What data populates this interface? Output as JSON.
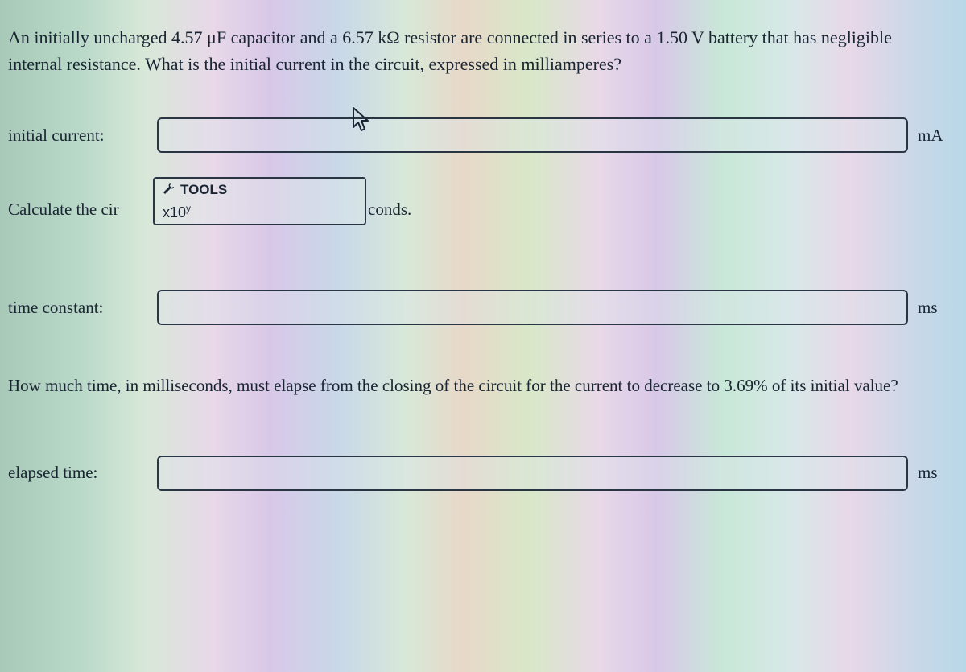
{
  "question": {
    "part1": "An initially uncharged 4.57 μF capacitor and a 6.57 kΩ resistor are connected in series to a 1.50 V battery that has negligible internal resistance. What is the initial current in the circuit, expressed in milliamperes?",
    "part2_visible_left": "Calculate the cir",
    "part2_visible_right": "conds.",
    "part3": "How much time, in milliseconds, must elapse from the closing of the circuit for the current to decrease to 3.69% of its initial value?"
  },
  "fields": {
    "initial_current": {
      "label": "initial current:",
      "unit": "mA",
      "value": ""
    },
    "time_constant": {
      "label": "time constant:",
      "unit": "ms",
      "value": ""
    },
    "elapsed_time": {
      "label": "elapsed time:",
      "unit": "ms",
      "value": ""
    }
  },
  "tools": {
    "header": "TOOLS",
    "sci_notation": "x10"
  }
}
